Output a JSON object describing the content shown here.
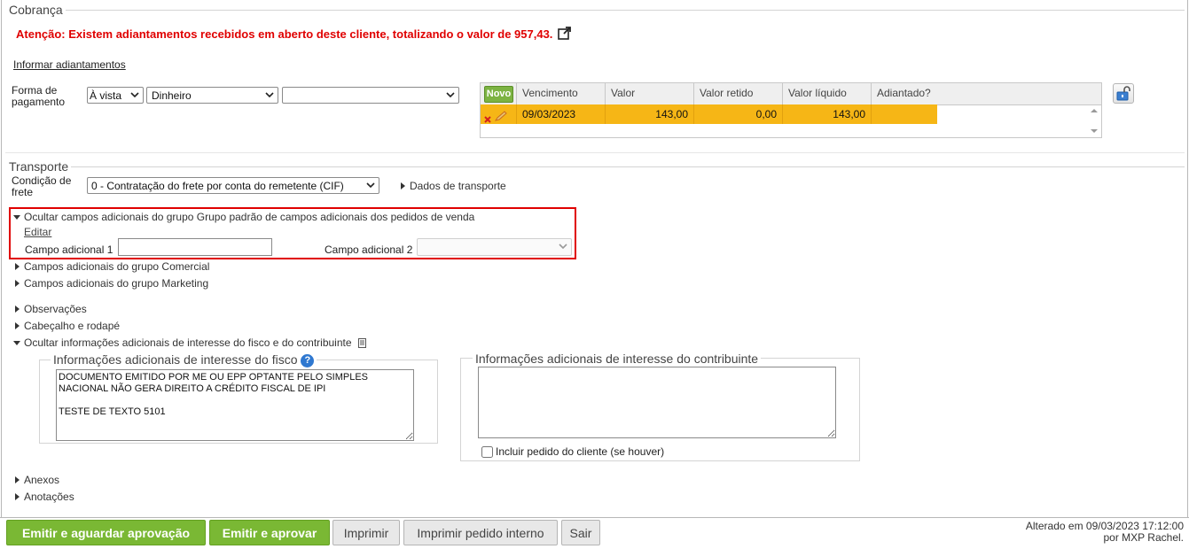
{
  "cobranca": {
    "title": "Cobrança",
    "warning": "Atenção: Existem adiantamentos recebidos em aberto deste cliente, totalizando o valor de 957,43.",
    "informar_link": "Informar adiantamentos",
    "forma_label_1": "Forma de",
    "forma_label_2": "pagamento",
    "payment_mode": "À vista",
    "payment_type": "Dinheiro",
    "payment_extra": "",
    "grid": {
      "new_button": "Novo",
      "columns": [
        "Vencimento",
        "Valor",
        "Valor retido",
        "Valor líquido",
        "Adiantado?"
      ],
      "rows": [
        {
          "vencimento": "09/03/2023",
          "valor": "143,00",
          "valor_retido": "0,00",
          "valor_liquido": "143,00",
          "adiantado": ""
        }
      ]
    }
  },
  "transporte": {
    "title": "Transporte",
    "condicao_label_1": "Condição de",
    "condicao_label_2": "frete",
    "condicao_value": "0 - Contratação do frete por conta do remetente (CIF)",
    "dados_link": "Dados de transporte"
  },
  "adicionais": {
    "group_header": "Ocultar campos adicionais do grupo Grupo padrão de campos adicionais dos pedidos de venda",
    "editar": "Editar",
    "campo1_label": "Campo adicional 1",
    "campo1_value": "",
    "campo2_label": "Campo adicional 2",
    "campo2_value": "",
    "group_comercial": "Campos adicionais do grupo Comercial",
    "group_marketing": "Campos adicionais do grupo Marketing"
  },
  "sections": {
    "observacoes": "Observações",
    "cabecalho": "Cabeçalho e rodapé",
    "info_fisco_toggle": "Ocultar informações adicionais de interesse do fisco e do contribuinte",
    "anexos": "Anexos",
    "anotacoes": "Anotações"
  },
  "fisco": {
    "legend": "Informações adicionais de interesse do fisco",
    "text": "DOCUMENTO EMITIDO POR ME OU EPP OPTANTE PELO SIMPLES NACIONAL NÃO GERA DIREITO A CRÉDITO FISCAL DE IPI\n\nTESTE DE TEXTO 5101"
  },
  "contribuinte": {
    "legend": "Informações adicionais de interesse do contribuinte",
    "text": "",
    "incluir_label": "Incluir pedido do cliente (se houver)"
  },
  "actions": {
    "emitir_aguardar": "Emitir e aguardar aprovação",
    "emitir_aprovar": "Emitir e aprovar",
    "imprimir": "Imprimir",
    "imprimir_interno": "Imprimir pedido interno",
    "sair": "Sair"
  },
  "footer": {
    "line1": "Alterado em 09/03/2023 17:12:00",
    "line2": "por MXP Rachel."
  },
  "colors": {
    "warning_red": "#e00000",
    "row_highlight": "#f6b616",
    "primary_green": "#7ab834"
  }
}
